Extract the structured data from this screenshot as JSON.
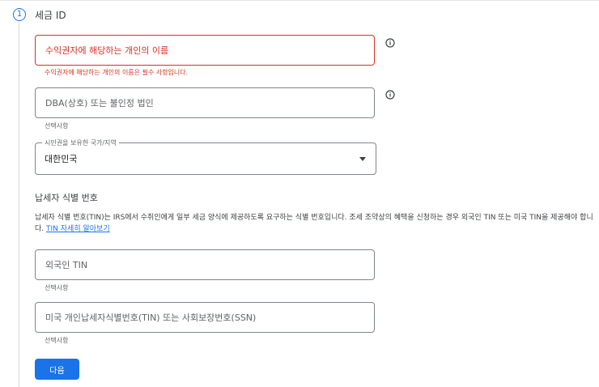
{
  "step": {
    "number": "1",
    "title": "세금 ID"
  },
  "form": {
    "payee_name": {
      "placeholder": "수익권자에 해당하는 개인의 이름",
      "error": "수익권자에 해당하는 개인의 이름은 필수 사항입니다."
    },
    "dba": {
      "placeholder": "DBA(상호) 또는 불인정 법인",
      "helper": "선택사항"
    },
    "citizenship": {
      "label": "시민권을 보유한 국가/지역",
      "value": "대한민국"
    },
    "tin_section": {
      "heading": "납세자 식별 번호",
      "description": "납세자 식별 번호(TIN)는 IRS에서 수취인에게 일부 세금 양식에 제공하도록 요구하는 식별 번호입니다. 조세 조약상의 혜택을 신청하는 경우 외국인 TIN 또는 미국 TIN을 제공해야 합니다.",
      "link": "TIN 자세히 알아보기"
    },
    "foreign_tin": {
      "placeholder": "외국인 TIN",
      "helper": "선택사항"
    },
    "us_tin": {
      "placeholder": "미국 개인납세자식별번호(TIN) 또는 사회보장번호(SSN)",
      "helper": "선택사항"
    }
  },
  "actions": {
    "next_label": "다음"
  },
  "colors": {
    "accent": "#1a73e8",
    "error": "#d93025"
  }
}
